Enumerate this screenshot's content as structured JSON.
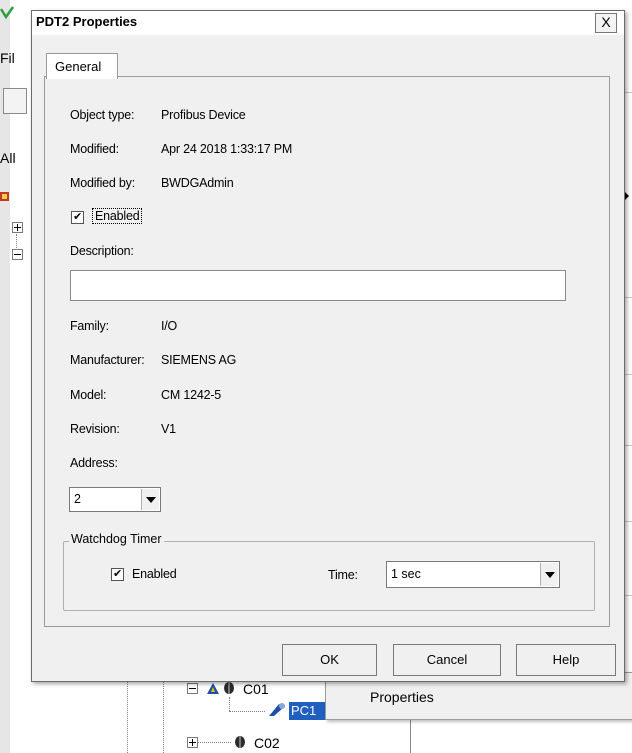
{
  "background_app": {
    "menu_fragment": "Fil",
    "tab_fragment": "All",
    "tree": {
      "node_c01": "C01",
      "node_c02": "C02",
      "selected_fragment": "PC1"
    },
    "popup_label": "Properties"
  },
  "dialog": {
    "title": "PDT2 Properties",
    "close_label": "X",
    "tabs": [
      {
        "label": "General",
        "active": true
      }
    ],
    "general": {
      "object_type": {
        "label": "Object type:",
        "value": "Profibus Device"
      },
      "modified": {
        "label": "Modified:",
        "value": "Apr 24 2018 1:33:17 PM"
      },
      "modified_by": {
        "label": "Modified by:",
        "value": "BWDGAdmin"
      },
      "enabled": {
        "label": "Enabled",
        "checked": true,
        "mark": "✔"
      },
      "description": {
        "label": "Description:",
        "value": ""
      },
      "family": {
        "label": "Family:",
        "value": "I/O"
      },
      "manufacturer": {
        "label": "Manufacturer:",
        "value": "SIEMENS AG"
      },
      "model": {
        "label": "Model:",
        "value": "CM 1242-5"
      },
      "revision": {
        "label": "Revision:",
        "value": "V1"
      },
      "address": {
        "label": "Address:",
        "value": "2"
      },
      "watchdog": {
        "title": "Watchdog Timer",
        "enabled": {
          "label": "Enabled",
          "checked": true,
          "mark": "✔"
        },
        "time": {
          "label": "Time:",
          "value": "1 sec"
        }
      }
    },
    "buttons": {
      "ok": "OK",
      "cancel": "Cancel",
      "help": "Help"
    }
  }
}
